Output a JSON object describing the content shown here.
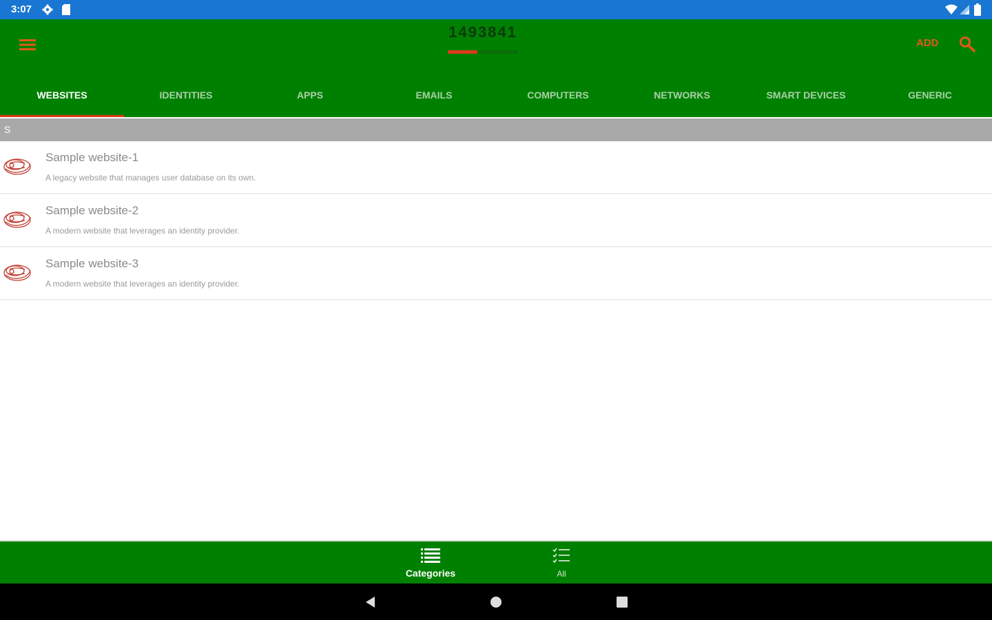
{
  "status_bar": {
    "time": "3:07"
  },
  "app_bar": {
    "title": "1493841",
    "progress": 0.42,
    "add_label": "ADD"
  },
  "tabs": [
    {
      "label": "WEBSITES",
      "active": true
    },
    {
      "label": "IDENTITIES",
      "active": false
    },
    {
      "label": "APPS",
      "active": false
    },
    {
      "label": "EMAILS",
      "active": false
    },
    {
      "label": "COMPUTERS",
      "active": false
    },
    {
      "label": "NETWORKS",
      "active": false
    },
    {
      "label": "SMART DEVICES",
      "active": false
    },
    {
      "label": "GENERIC",
      "active": false
    }
  ],
  "section": {
    "letter": "S"
  },
  "items": [
    {
      "title": "Sample website-1",
      "description": "A legacy website that manages user database on its own."
    },
    {
      "title": "Sample website-2",
      "description": "A modern website that leverages an identity provider."
    },
    {
      "title": "Sample website-3",
      "description": "A modern website that leverages an identity provider."
    }
  ],
  "bottom_nav": {
    "categories_label": "Categories",
    "all_label": "All"
  },
  "icons": {
    "menu": "menu-icon",
    "search": "search-icon",
    "item": "website-doodle-icon",
    "categories": "list-icon",
    "all": "checklist-icon"
  },
  "colors": {
    "app_bar": "#008000",
    "status_bar": "#1976d2",
    "accent": "#e0391b",
    "section_header": "#a9a9a9"
  }
}
